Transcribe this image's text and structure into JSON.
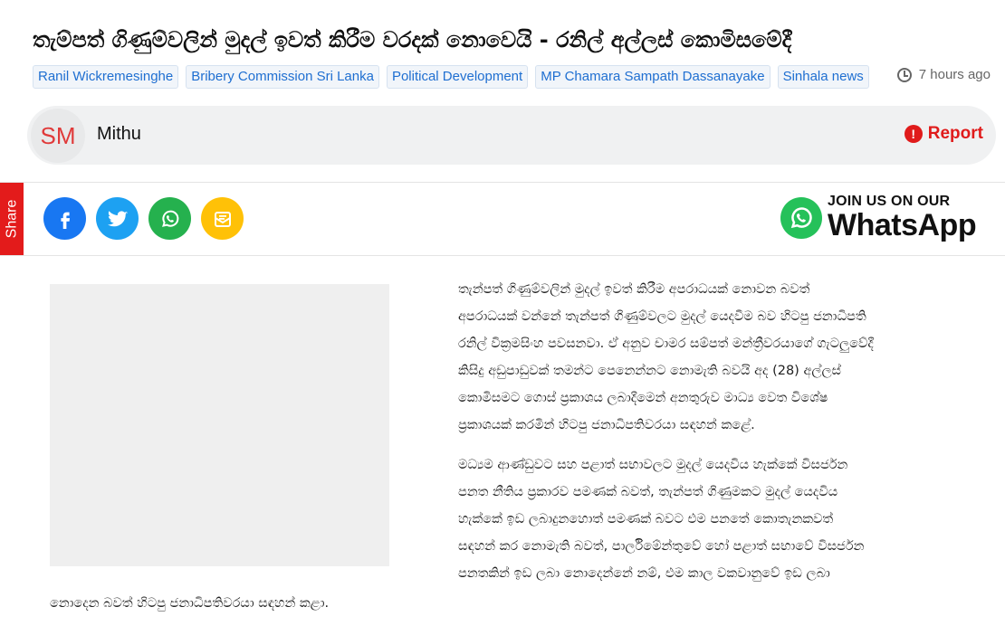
{
  "article": {
    "title": "තැම්පත් ගිණුම්වලින් මුදල් ඉවත් කිරීම වරදක් නොවෙයි - රනිල් අල්ලස් කොමිසමේදී",
    "tags": [
      "Ranil Wickremesinghe",
      "Bribery Commission Sri Lanka",
      "Political Development",
      "MP Chamara Sampath Dassanayake",
      "Sinhala news"
    ],
    "time_ago": "7 hours ago",
    "paragraph1_lines": [
      "තැන්පත් ගිණුම්වලින් මුදල් ඉවත් කිරීම අපරාධයක් නොවන බවත්",
      "අපරාධයක් වන්නේ තැන්පත් ගිණුම්වලට මුදල් යෙදවීම බව හිටපු ජනාධිපති",
      "රනිල් වික්‍රමසිංහ පවසනවා. ඒ අනුව චාමර සම්පත් මන්ත්‍රීවරයාගේ ගැටලුවේදී",
      "කිසිදු අඩුපාඩුවක් තමන්ට පෙනෙන්නට නොමැති බවයි අද (28) අල්ලස්",
      "කොමිසමට ගොස් ප්‍රකාශය ලබාදීමෙන් අනතුරුව මාධ්‍ය වෙත විශේෂ",
      "ප්‍රකාශයක් කරමින් හිටපු ජනාධිපතිවරයා සඳහන් කළේ."
    ],
    "paragraph2_lines": [
      "මධ්‍යම ආණ්ඩුවට සහ පළාත් සභාවලට මුදල් යෙදවිය හැක්කේ විසර්ජන",
      "පනත නීතිය ප්‍රකාරව පමණක් බවත්, තැන්පත් ගිණුමකට මුදල් යෙදවිය",
      "හැක්කේ ඉඩ ලබාදුනහොත් පමණක් බවට එම පනතේ කොතැනකවත්",
      "සඳහන් කර නොමැති බවත්, පාර්ලිමේන්තුවේ හෝ පළාත් සභාවේ විසර්ජන",
      "පනතකින් ඉඩ ලබා නොදෙන්නේ නම්, එම කාල වකවානුවේ ඉඩ ලබා"
    ],
    "paragraph2_tail": "නොදෙන බවත් හිටපු ජනාධිපතිවරයා සඳහන් කළා."
  },
  "author": {
    "initials": "SM",
    "name": "Mithu",
    "report_label": "Report"
  },
  "share": {
    "label": "Share",
    "buttons": [
      {
        "name": "facebook-icon",
        "color": "#1877f2"
      },
      {
        "name": "twitter-icon",
        "color": "#1da1f2"
      },
      {
        "name": "whatsapp-icon",
        "color": "#25b14e"
      },
      {
        "name": "email-icon",
        "color": "#ffc107"
      }
    ]
  },
  "whatsapp_banner": {
    "line1": "JOIN US ON OUR",
    "line2": "WhatsApp",
    "color": "#25c15a"
  }
}
